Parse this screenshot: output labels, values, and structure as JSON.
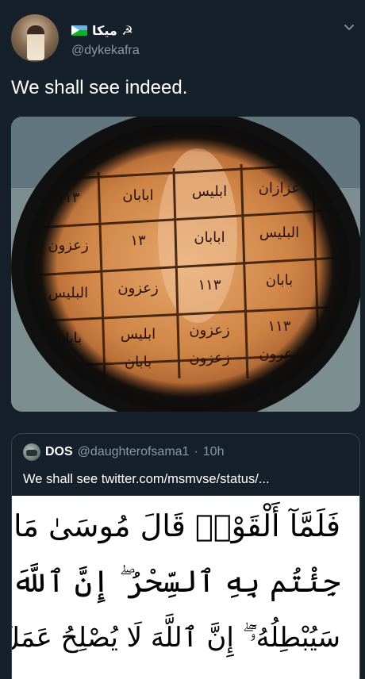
{
  "tweet": {
    "display_name": "ميكا ☭",
    "flag_icon": "djibouti-flag-icon",
    "handle": "@dykekafra",
    "text": "We shall see indeed.",
    "menu_icon": "chevron-down-icon"
  },
  "media": {
    "description_icon": "magnifier-over-grid-photo",
    "grid_rows": [
      [
        "١١٣",
        "ابابان",
        "ابليس",
        "عزازان"
      ],
      [
        "زعزون",
        "١٣",
        "ابابان",
        "البليس"
      ],
      [
        "البليس",
        "زعزون",
        "١١٣",
        "بابان"
      ],
      [
        "بابان",
        "ابليس",
        "زعزون",
        "١١٣"
      ],
      [
        "",
        "بابان",
        "زعزون",
        "زعرون"
      ]
    ]
  },
  "quote": {
    "name": "DOS",
    "handle": "@daughterofsama1",
    "separator": "·",
    "time": "10h",
    "text": "We shall see twitter.com/msmvse/status/...",
    "arabic_lines": [
      "فَلَمَّآ أَلْقَوْا۟ قَالَ مُوسَىٰ مَا",
      "جِئْتُم بِهِ ٱلسِّحْرُ ۖ إِنَّ ٱللَّهَ",
      "سَيُبْطِلُهُۥٓ ۖ إِنَّ ٱللَّهَ لَا يُصْلِحُ عَمَلَ"
    ]
  },
  "colors": {
    "background": "#15202b",
    "secondary_text": "#8899a6",
    "border": "#38444d"
  }
}
